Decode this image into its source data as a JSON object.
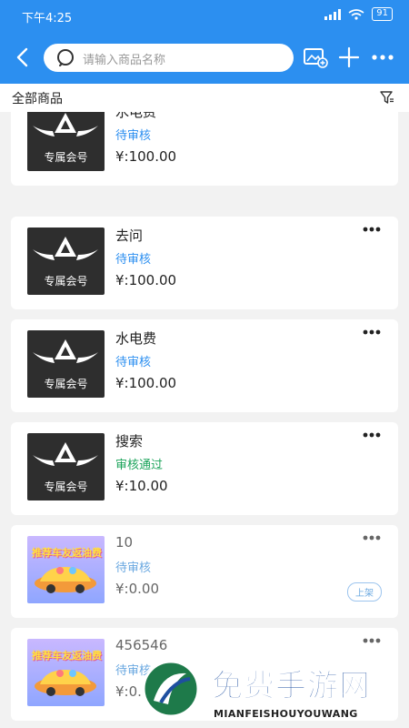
{
  "status_bar": {
    "time": "下午4:25",
    "battery": "91"
  },
  "search": {
    "placeholder": "请输入商品名称"
  },
  "filter_bar": {
    "title": "全部商品"
  },
  "icons": {
    "back": "back-arrow-icon",
    "search": "search-icon",
    "image_add": "image-add-icon",
    "add": "plus-icon",
    "more": "more-dots-icon",
    "filter": "filter-icon"
  },
  "colors": {
    "primary": "#2c8ff0",
    "pending": "#2c8ff0",
    "approved": "#1aa35a"
  },
  "products": [
    {
      "name": "水电费",
      "status": "待审核",
      "price": "¥:100.00",
      "thumb": "black",
      "thumb_label": "专属会号"
    },
    {
      "name": "去问",
      "status": "待审核",
      "price": "¥:100.00",
      "thumb": "black",
      "thumb_label": "专属会号"
    },
    {
      "name": "水电费",
      "status": "待审核",
      "price": "¥:100.00",
      "thumb": "black",
      "thumb_label": "专属会号"
    },
    {
      "name": "搜索",
      "status": "审核通过",
      "price": "¥:10.00",
      "thumb": "black",
      "thumb_label": "专属会号"
    },
    {
      "name": "10",
      "status": "待审核",
      "price": "¥:0.00",
      "thumb": "promo",
      "thumb_label": "推荐车友返油费",
      "action": "上架"
    },
    {
      "name": "456546",
      "status": "待审核",
      "price": "¥:0.00",
      "thumb": "promo",
      "thumb_label": "推荐车友返油费"
    }
  ],
  "watermark": {
    "title": "免费手游网",
    "subtitle": "MIANFEISHOUYOUWANG"
  }
}
